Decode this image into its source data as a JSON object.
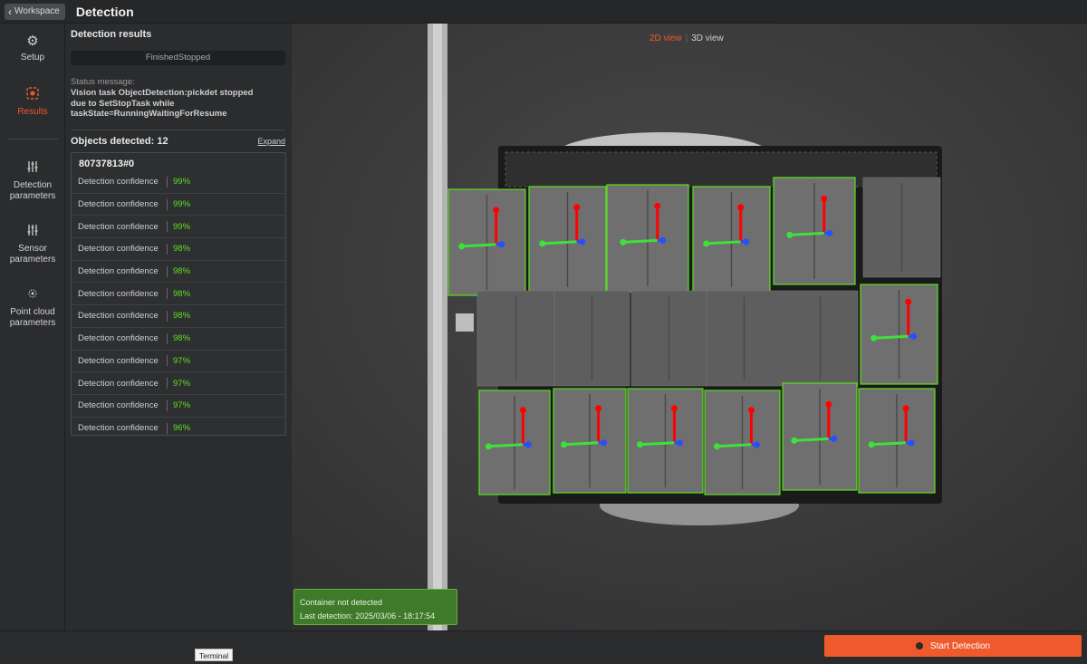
{
  "topbar": {
    "back_label": "Workspace",
    "title": "Detection"
  },
  "sidenav": {
    "items": [
      {
        "label": "Setup",
        "icon": "gear-icon"
      },
      {
        "label": "Results",
        "icon": "results-icon",
        "active": true
      },
      {
        "label": "Detection parameters",
        "icon": "sliders-icon"
      },
      {
        "label": "Sensor parameters",
        "icon": "sliders-icon"
      },
      {
        "label": "Point cloud parameters",
        "icon": "point-cloud-icon"
      }
    ]
  },
  "results": {
    "title": "Detection results",
    "status_pill": "FinishedStopped",
    "status_label": "Status message:",
    "status_message": "Vision task ObjectDetection:pickdet stopped due to SetStopTask while taskState=RunningWaitingForResume",
    "objects_label": "Objects detected: 12",
    "expand_label": "Expand",
    "object_id": "80737813#0",
    "confidence_label": "Detection confidence",
    "confidences": [
      "99%",
      "99%",
      "99%",
      "98%",
      "98%",
      "98%",
      "98%",
      "98%",
      "97%",
      "97%",
      "97%",
      "96%"
    ]
  },
  "viewer": {
    "view_2d": "2D view",
    "view_3d": "3D view",
    "active_view": "2D view",
    "container_status": "Container not detected",
    "last_detection_label": "Last detection:",
    "last_detection_value": "2025/03/06 - 18:17:54"
  },
  "bottom": {
    "terminal_label": "Terminal",
    "start_label": "Start Detection"
  },
  "colors": {
    "accent": "#ee5a2c",
    "detection_box": "#5ee01e",
    "confidence_text": "#5ee01e"
  }
}
